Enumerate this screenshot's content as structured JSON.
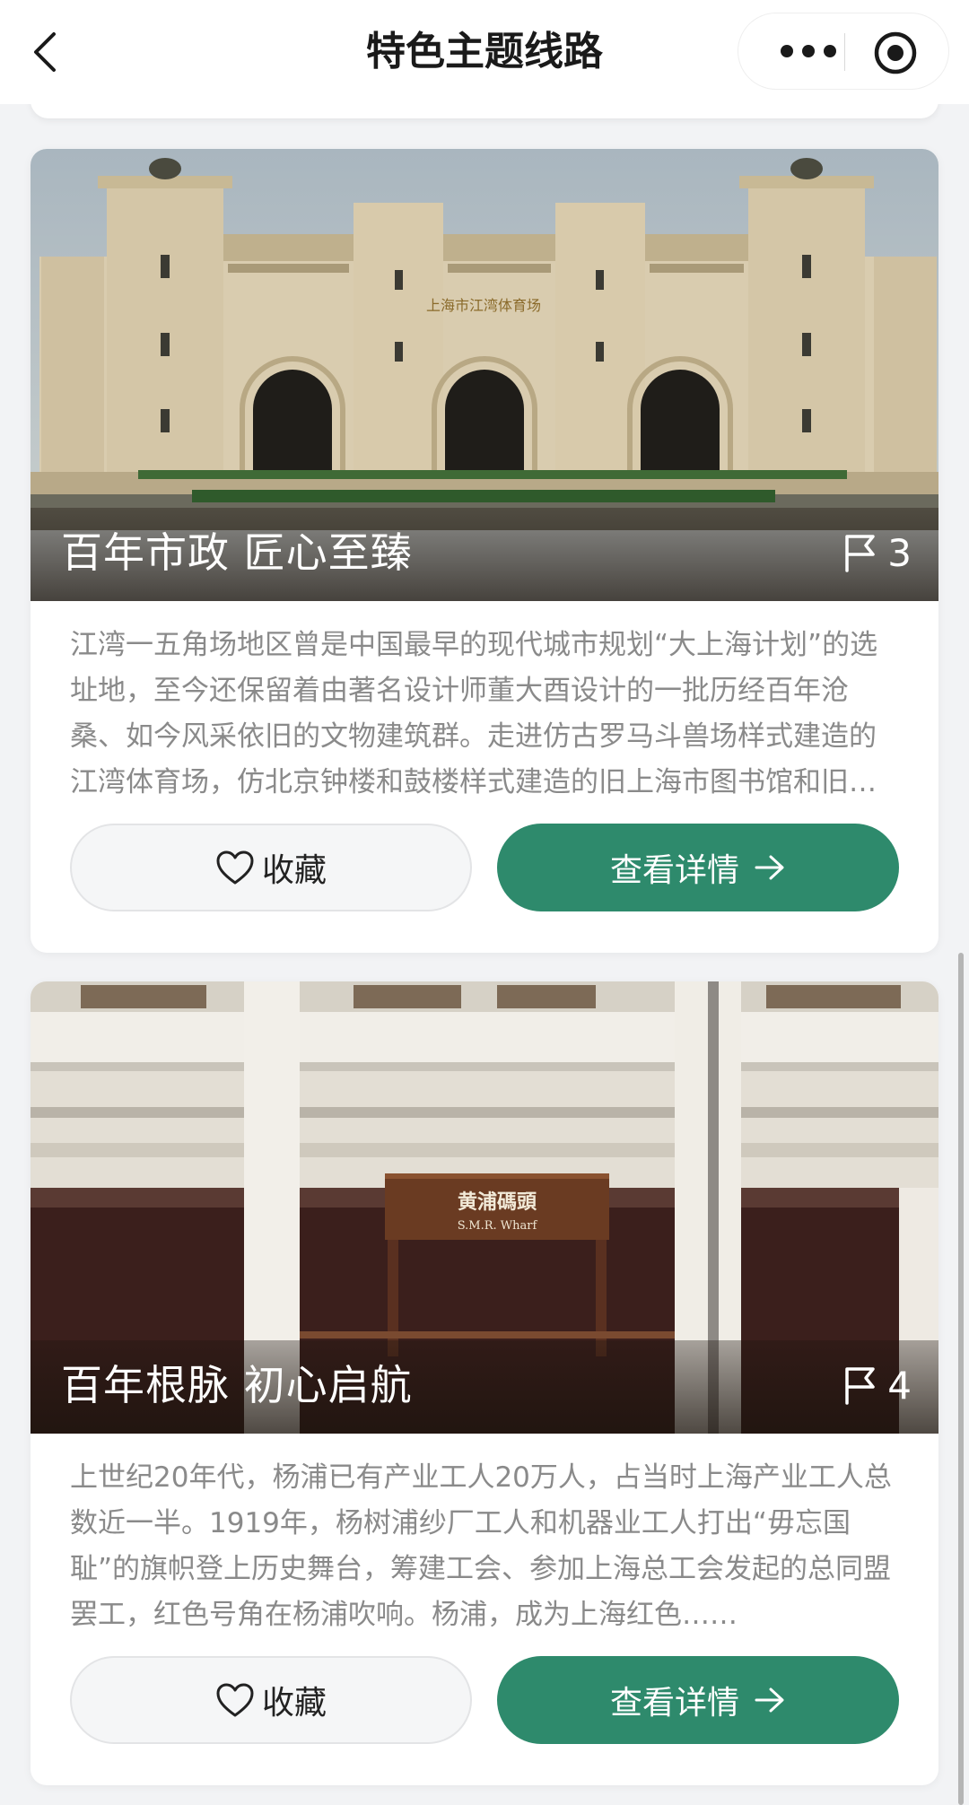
{
  "nav": {
    "title": "特色主题线路"
  },
  "routes": [
    {
      "title": "百年市政 匠心至臻",
      "stops": "3",
      "description": "江湾一五角场地区曾是中国最早的现代城市规划“大上海计划”的选址地，至今还保留着由著名设计师董大酉设计的一批历经百年沧桑、如今风采依旧的文物建筑群。走进仿古罗马斗兽场样式建造的江湾体育场，仿北京钟楼和鼓楼样式建造的旧上海市图书馆和旧上海市博物馆……",
      "image_sign_text": "上海市江湾体育场",
      "favorite_label": "收藏",
      "detail_label": "查看详情"
    },
    {
      "title": "百年根脉 初心启航",
      "stops": "4",
      "description": "上世纪20年代，杨浦已有产业工人20万人，占当时上海产业工人总数近一半。1919年，杨树浦纱厂工人和机器业工人打出“毋忘国耻”的旗帜登上历史舞台，筹建工会、参加上海总工会发起的总同盟罢工，红色号角在杨浦吹响。杨浦，成为上海红色……",
      "image_sign_text": "黄浦碼頭",
      "image_sign_subtext": "S.M.R. Wharf",
      "favorite_label": "收藏",
      "detail_label": "查看详情"
    }
  ],
  "colors": {
    "primary_button": "#2e8a6c",
    "page_background": "#f2f3f5",
    "description_text": "#8a8a8a"
  },
  "icons": [
    "back-icon",
    "more-dots-icon",
    "target-icon",
    "flag-icon",
    "heart-icon",
    "arrow-right-icon"
  ]
}
